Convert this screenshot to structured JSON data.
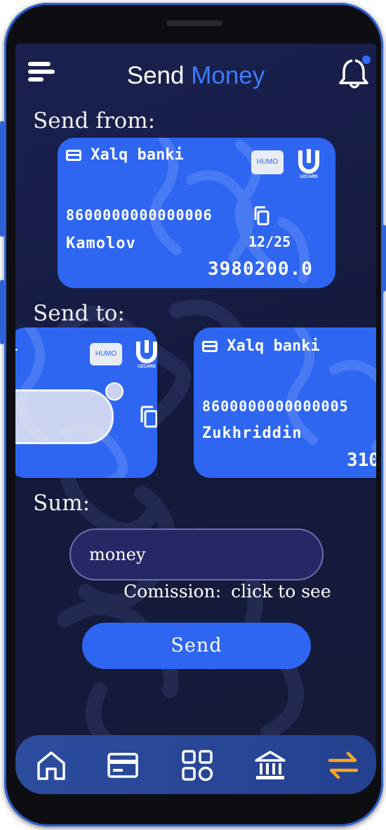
{
  "header": {
    "title_main": "Send",
    "title_accent": "Money",
    "menu_icon": "menu-icon",
    "bell_icon": "bell-icon",
    "accent_color": "#3b7cff",
    "notification_dot_color": "#2f6bff"
  },
  "send_from": {
    "label": "Send from:",
    "card": {
      "bank": "Xalq banki",
      "number": "8600000000000006",
      "holder": "Kamolov",
      "expiry": "12/25",
      "balance": "3980200.0",
      "humo_label": "HUMO",
      "uzcard_label": "UZCARD"
    }
  },
  "send_to": {
    "label": "Send to:",
    "cards": [
      {
        "humo_label": "HUMO",
        "uzcard_label": "UZCARD"
      },
      {
        "bank": "Xalq banki",
        "number": "8600000000000005",
        "holder": "Zukhriddin",
        "balance": "310"
      }
    ]
  },
  "sum": {
    "label": "Sum:",
    "placeholder": "money",
    "commission_label": "Comission:",
    "commission_action": "click to see"
  },
  "send_button": {
    "label": "Send"
  },
  "bottom_nav": {
    "items": [
      "home-icon",
      "card-icon",
      "apps-grid-icon",
      "bank-icon",
      "transfer-icon"
    ],
    "active": "transfer-icon",
    "active_color": "#f5a623",
    "color": "#ffffff"
  },
  "colors": {
    "card": "#2e66f1",
    "background": "#161c42",
    "button": "#2e66f1"
  }
}
